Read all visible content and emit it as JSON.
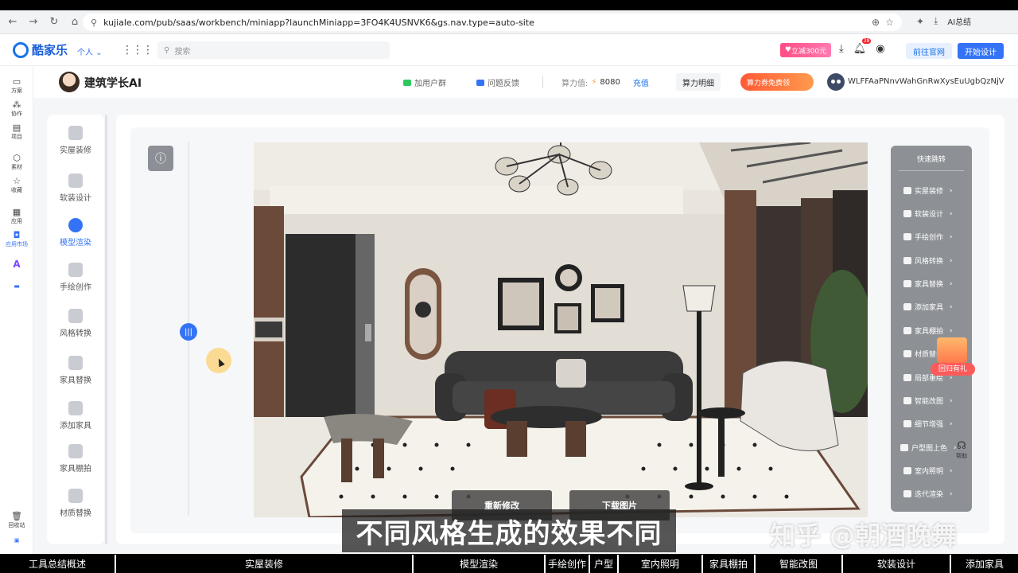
{
  "browser": {
    "url": "kujiale.com/pub/saas/workbench/miniapp?launchMiniapp=3FO4K4USNVK6&gs.nav.type=auto-site",
    "ai_chip": "AI总结"
  },
  "header": {
    "logo_text": "酷家乐",
    "persona": "个人",
    "search_placeholder": "搜索",
    "promo": "立减300元",
    "notif_count": "38",
    "goto_site": "前往官网",
    "start_design": "开始设计"
  },
  "rail": {
    "items": [
      "方案",
      "协作",
      "项目",
      "素材",
      "收藏",
      "应用",
      "应用市场"
    ],
    "recycle": "回收站"
  },
  "subheader": {
    "brand": "建筑学长AI",
    "join_group": "加用户群",
    "feedback": "问题反馈",
    "compute_label": "算力值:",
    "compute_value": "8080",
    "recharge": "充值",
    "compute_detail": "算力明细",
    "coupon": "算力券免费领",
    "username": "WLFFAaPNnvWahGnRwXysEuUgbQzNjV"
  },
  "tools": [
    {
      "label": "实屋装修",
      "active": false
    },
    {
      "label": "软装设计",
      "active": false
    },
    {
      "label": "模型渲染",
      "active": true
    },
    {
      "label": "手绘创作",
      "active": false
    },
    {
      "label": "风格转换",
      "active": false
    },
    {
      "label": "家具替换",
      "active": false
    },
    {
      "label": "添加家具",
      "active": false
    },
    {
      "label": "家具棚拍",
      "active": false
    },
    {
      "label": "材质替换",
      "active": false
    }
  ],
  "canvas": {
    "regenerate": "重新修改",
    "download": "下载图片"
  },
  "quick_jump": {
    "title": "快速跳转",
    "items": [
      "实屋装修",
      "软装设计",
      "手绘创作",
      "风格转换",
      "家具替换",
      "添加家具",
      "家具棚拍",
      "材质替换",
      "局部重绘",
      "智能改图",
      "细节增强",
      "户型图上色",
      "室内照明",
      "迭代渲染"
    ]
  },
  "gift_label": "回归有礼",
  "help_label": "帮助",
  "caption": "不同风格生成的效果不同",
  "watermark": "知乎 @朝酒晚舞",
  "chapters": [
    "工具总结概述",
    "实屋装修",
    "模型渲染",
    "手绘创作",
    "户型",
    "室内照明",
    "家具棚拍",
    "智能改图",
    "软装设计",
    "添加家具"
  ],
  "colors": {
    "accent": "#3573f6",
    "quick_panel": "#8d9196",
    "coupon": "#ff6a3d"
  }
}
